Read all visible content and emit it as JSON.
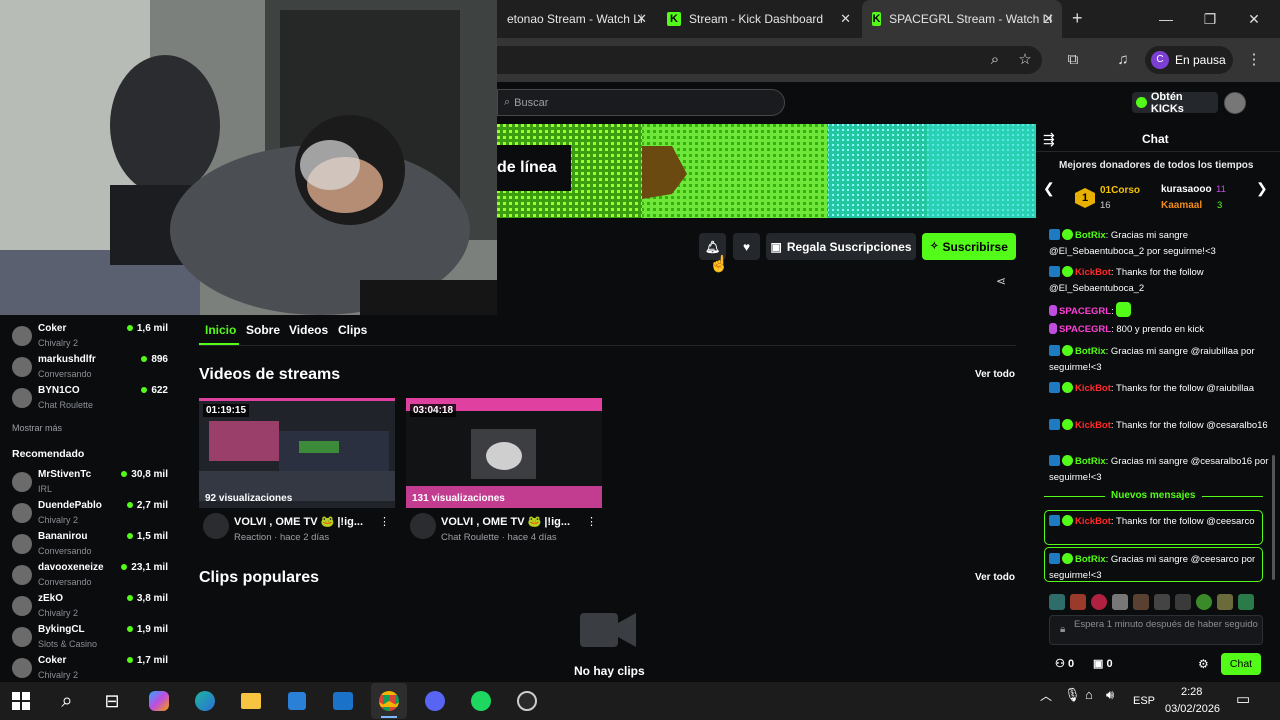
{
  "browser": {
    "tabs": [
      {
        "title": "etonao Stream - Watch Li",
        "active": false
      },
      {
        "title": "Stream - Kick Dashboard",
        "active": false
      },
      {
        "title": "SPACEGRL Stream - Watch Li",
        "active": true
      }
    ],
    "new_tab": "+",
    "profile_initial": "C",
    "profile_status": "En pausa",
    "icons": [
      "zoom-icon",
      "star-icon",
      "extensions-icon",
      "media-icon",
      "menu-icon"
    ]
  },
  "kick": {
    "search_placeholder": "Buscar",
    "kicks_label": "Obtén KICKs",
    "banner_text": "de línea",
    "buttons": {
      "gift_label": "Regala Suscripciones",
      "subscribe_label": "Suscribirse"
    }
  },
  "sidebar": {
    "following": [
      {
        "name": "Coker",
        "category": "Chivalry 2",
        "viewers": "1,6 mil"
      },
      {
        "name": "markushdlfr",
        "category": "Conversando",
        "viewers": "896"
      },
      {
        "name": "BYN1CO",
        "category": "Chat Roulette",
        "viewers": "622"
      }
    ],
    "show_more": "Mostrar más",
    "recommended_heading": "Recomendado",
    "recommended": [
      {
        "name": "MrStivenTc",
        "category": "IRL",
        "viewers": "30,8 mil"
      },
      {
        "name": "DuendePablo",
        "category": "Chivalry 2",
        "viewers": "2,7 mil"
      },
      {
        "name": "Bananirou",
        "category": "Conversando",
        "viewers": "1,5 mil"
      },
      {
        "name": "davooxeneize",
        "category": "Conversando",
        "viewers": "23,1 mil"
      },
      {
        "name": "zEkO",
        "category": "Chivalry 2",
        "viewers": "3,8 mil"
      },
      {
        "name": "BykingCL",
        "category": "Slots & Casino",
        "viewers": "1,9 mil"
      },
      {
        "name": "Coker",
        "category": "Chivalry 2",
        "viewers": "1,7 mil"
      }
    ]
  },
  "main": {
    "tabs": [
      "Inicio",
      "Sobre",
      "Videos",
      "Clips"
    ],
    "active_tab": "Inicio",
    "videos_heading": "Videos de streams",
    "clips_heading": "Clips populares",
    "see_all": "Ver todo",
    "videos": [
      {
        "duration": "01:19:15",
        "views": "92 visualizaciones",
        "title": "VOLVI , OME TV 🐸 |!ig...",
        "category": "Reaction",
        "date": "hace 2 días"
      },
      {
        "duration": "03:04:18",
        "views": "131 visualizaciones",
        "title": "VOLVI , OME TV 🐸 |!ig...",
        "category": "Chat Roulette",
        "date": "hace 4 días"
      }
    ],
    "no_clips": "No hay clips"
  },
  "chat": {
    "title": "Chat",
    "donors_heading": "Mejores donadores de todos los tiempos",
    "donors": [
      {
        "rank": "1",
        "name": "01Corso",
        "amount": "16"
      },
      {
        "name": "kurasaooo",
        "amount": "11"
      },
      {
        "name": "Kaamaal",
        "amount": "3"
      }
    ],
    "messages": [
      {
        "user": "BotRix",
        "text": ": Gracias mi sangre @El_Sebaentuboca_2 por seguirme!<3"
      },
      {
        "user": "KickBot",
        "text": ": Thanks for the follow @El_Sebaentuboca_2"
      },
      {
        "user": "SPACEGRL",
        "text": ":"
      },
      {
        "user": "SPACEGRL",
        "text": ": 800 y prendo en kick"
      },
      {
        "user": "BotRix",
        "text": ": Gracias mi sangre @raiubillaa por seguirme!<3"
      },
      {
        "user": "KickBot",
        "text": ": Thanks for the follow @raiubillaa"
      },
      {
        "user": "KickBot",
        "text": ": Thanks for the follow @cesaralbo16"
      },
      {
        "user": "BotRix",
        "text": ": Gracias mi sangre @cesaralbo16 por seguirme!<3"
      },
      {
        "user": "KickBot",
        "text": ": Thanks for the follow @ceesarco"
      },
      {
        "user": "BotRix",
        "text": ": Gracias mi sangre @ceesarco por seguirme!<3"
      }
    ],
    "new_messages": "Nuevos mensajes",
    "input_placeholder": "Espera 1 minuto después de haber seguido",
    "stat1": "0",
    "stat2": "0",
    "send_label": "Chat"
  },
  "taskbar": {
    "lang": "ESP",
    "time": "2:28",
    "date": "03/02/2026"
  },
  "colors": {
    "accent": "#53fc18",
    "bg": "#0b0c0e",
    "bot_red": "#ff2a2a"
  }
}
